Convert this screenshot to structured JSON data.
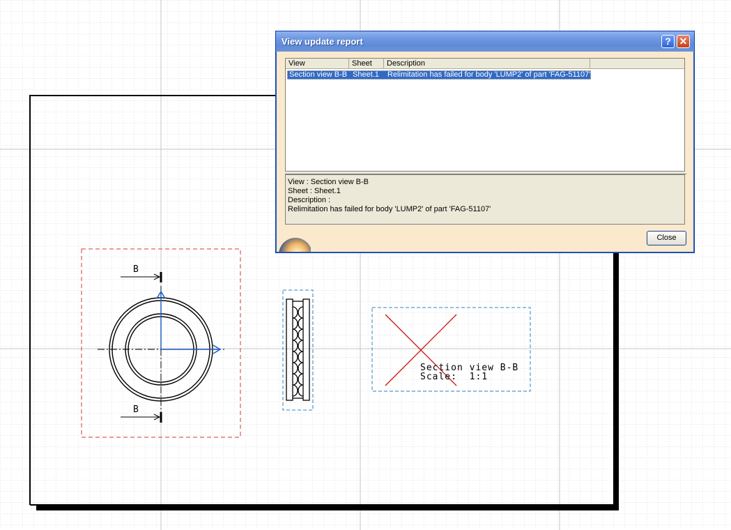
{
  "drawing": {
    "section_label_top": "B",
    "section_label_bottom": "B",
    "section_view_title": "Section view B-B",
    "section_view_scale": "Scale:  1:1"
  },
  "dialog": {
    "title": "View update report",
    "help_label": "?",
    "close_x_label": "✕",
    "columns": {
      "view": "View",
      "sheet": "Sheet",
      "description": "Description"
    },
    "rows": [
      {
        "view": "Section view B-B",
        "sheet": "Sheet.1",
        "description": "Relimitation has failed for body 'LUMP2' of part 'FAG-51107'"
      }
    ],
    "details": {
      "view_line": "View : Section view B-B",
      "sheet_line": "Sheet : Sheet.1",
      "description_line": "Description :",
      "message_line": "Relimitation has failed for body 'LUMP2' of part 'FAG-51107'"
    },
    "close_button": "Close"
  },
  "colors": {
    "grid": "#c8c8c8",
    "frame": "#000000",
    "view_frame_red": "#d23a3a",
    "view_frame_blue": "#2f86c6",
    "axis_blue": "#1f5fc2",
    "cross_red": "#cc1111",
    "selection": "#316ac5"
  }
}
